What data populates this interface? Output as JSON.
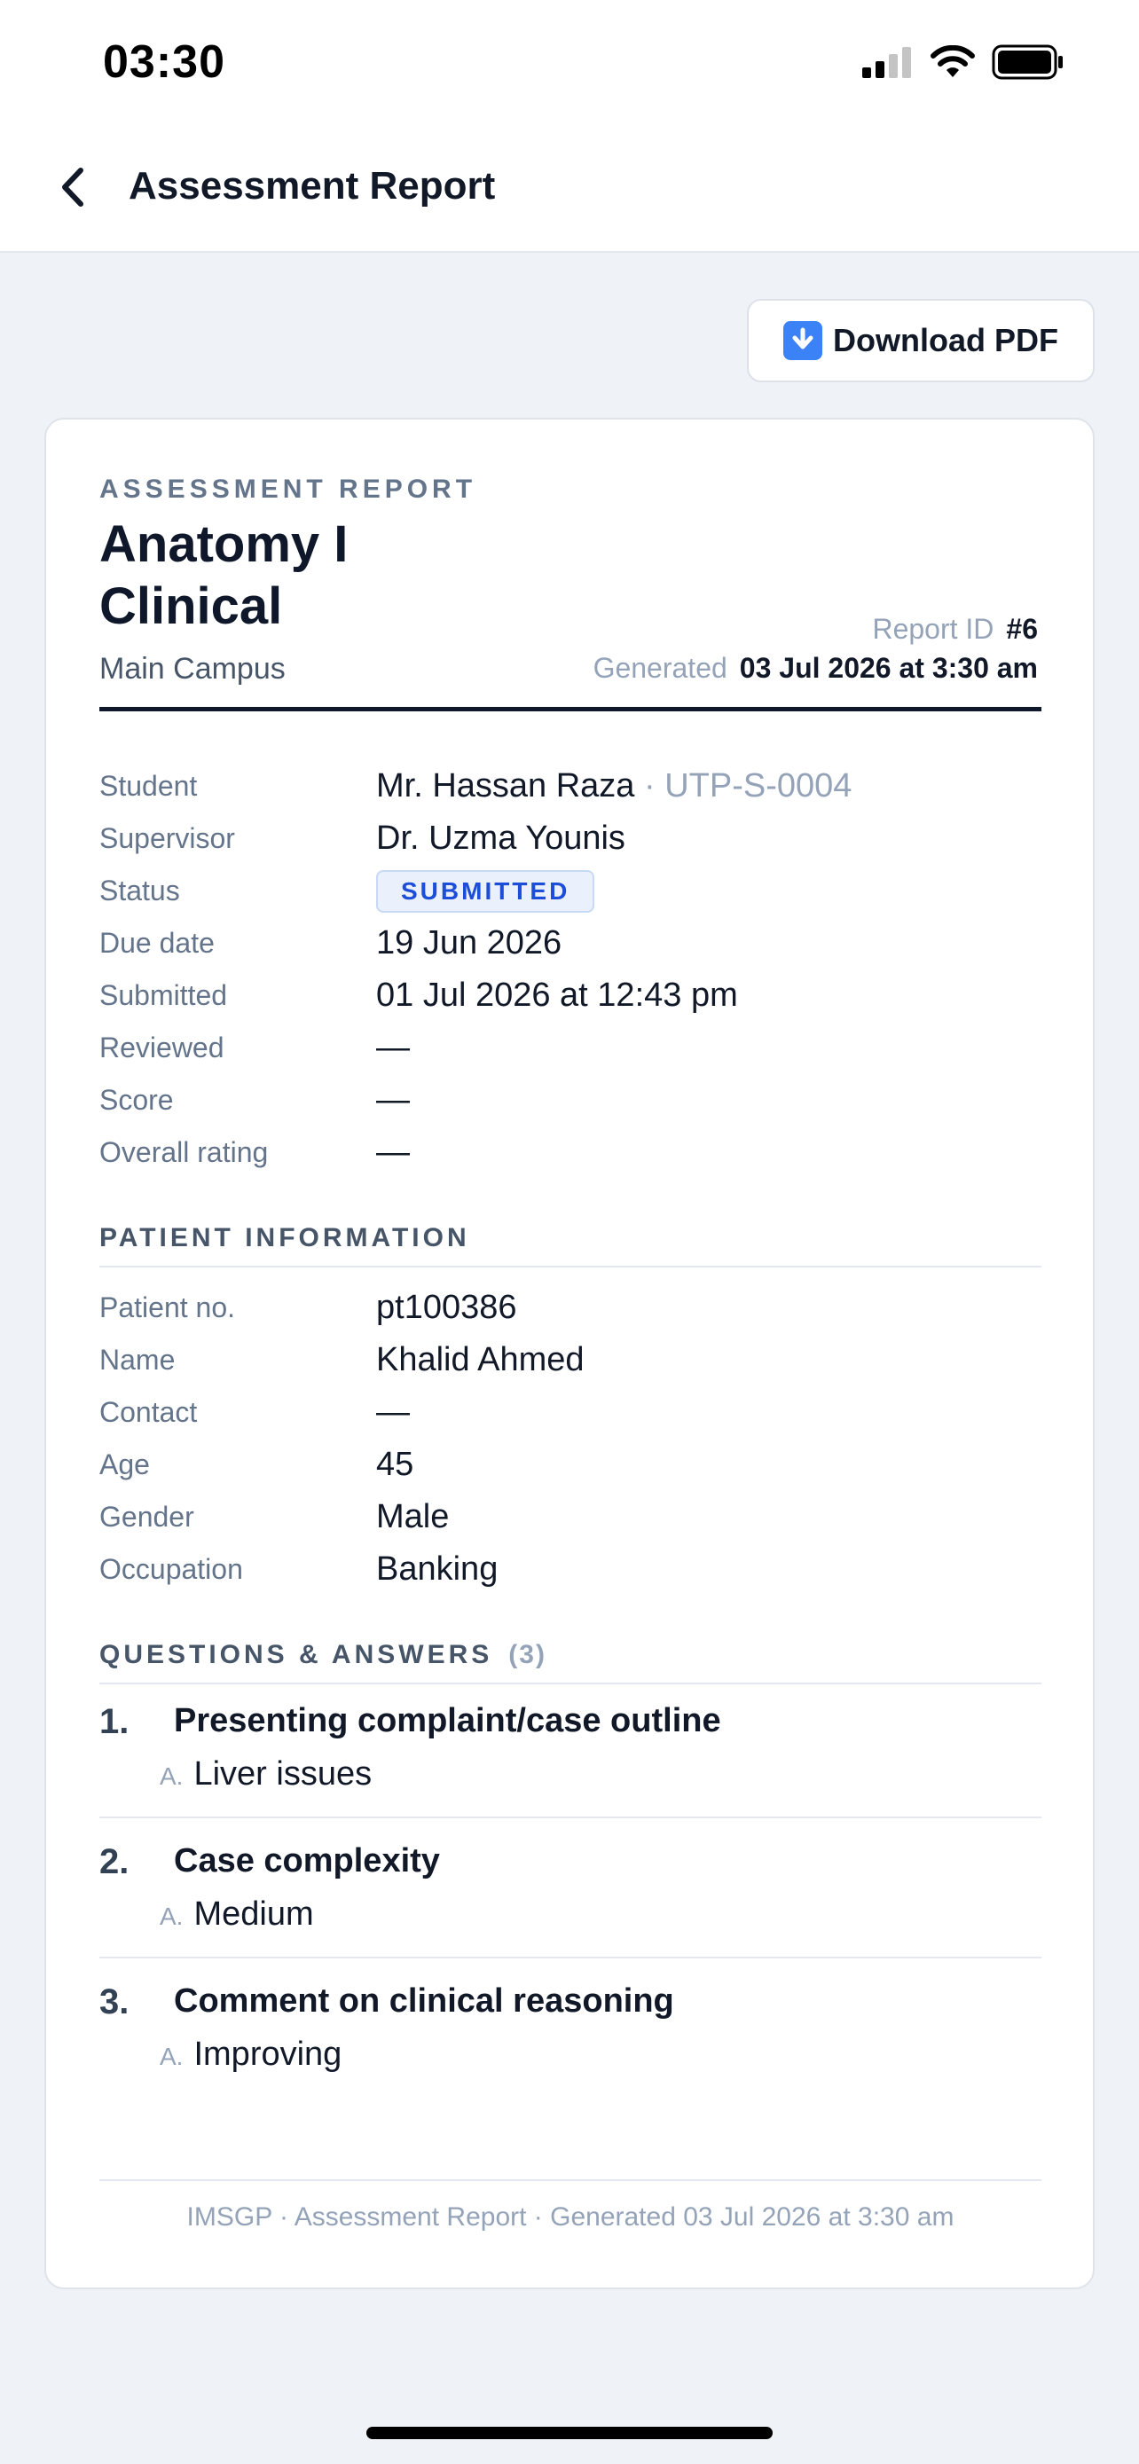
{
  "status_bar": {
    "time": "03:30"
  },
  "header": {
    "title": "Assessment Report"
  },
  "actions": {
    "download_label": "Download PDF"
  },
  "report": {
    "eyebrow": "ASSESSMENT REPORT",
    "title": "Anatomy I Clinical",
    "campus": "Main Campus",
    "report_id_label": "Report ID",
    "report_id": "#6",
    "generated_label": "Generated",
    "generated": "03 Jul 2026 at 3:30 am"
  },
  "details": {
    "student_label": "Student",
    "student_name": "Mr. Hassan Raza",
    "student_id": "· UTP-S-0004",
    "supervisor_label": "Supervisor",
    "supervisor": "Dr. Uzma Younis",
    "status_label": "Status",
    "status": "SUBMITTED",
    "due_label": "Due date",
    "due": "19 Jun 2026",
    "submitted_label": "Submitted",
    "submitted": "01 Jul 2026 at 12:43 pm",
    "reviewed_label": "Reviewed",
    "reviewed": "—",
    "score_label": "Score",
    "score": "—",
    "rating_label": "Overall rating",
    "rating": "—"
  },
  "patient": {
    "heading": "PATIENT INFORMATION",
    "no_label": "Patient no.",
    "no": "pt100386",
    "name_label": "Name",
    "name": "Khalid Ahmed",
    "contact_label": "Contact",
    "contact": "—",
    "age_label": "Age",
    "age": "45",
    "gender_label": "Gender",
    "gender": "Male",
    "occupation_label": "Occupation",
    "occupation": "Banking"
  },
  "qa": {
    "heading": "QUESTIONS & ANSWERS",
    "count": "(3)",
    "answer_marker": "A.",
    "items": [
      {
        "num": "1.",
        "question": "Presenting complaint/case outline",
        "answer": "Liver issues"
      },
      {
        "num": "2.",
        "question": "Case complexity",
        "answer": "Medium"
      },
      {
        "num": "3.",
        "question": "Comment on clinical reasoning",
        "answer": "Improving"
      }
    ]
  },
  "footer": {
    "text": "IMSGP · Assessment Report · Generated 03 Jul 2026 at 3:30 am"
  }
}
